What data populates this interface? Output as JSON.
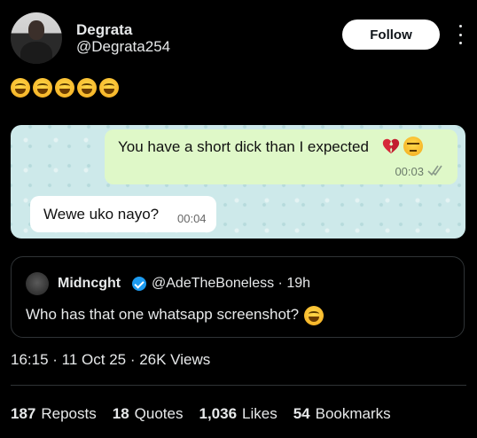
{
  "author": {
    "name": "Degrata",
    "handle": "@Degrata254"
  },
  "follow_label": "Follow",
  "post_emojis": [
    "grinning-squint-emoji",
    "grinning-squint-emoji",
    "grinning-squint-emoji",
    "grinning-squint-emoji",
    "grinning-squint-emoji"
  ],
  "chat": {
    "outgoing": {
      "text": "You have a short dick than I expected",
      "emojis": [
        "broken-heart-emoji",
        "unamused-face-emoji"
      ],
      "time": "00:03"
    },
    "incoming": {
      "text": "Wewe uko nayo?",
      "time": "00:04"
    }
  },
  "quote": {
    "name": "Midncght",
    "handle": "@AdeTheBoneless · 19h",
    "text": "Who has that one whatsapp screenshot?",
    "emoji": "grinning-squint-emoji"
  },
  "meta": "16:15 · 11 Oct 25 · 26K Views",
  "stats": [
    {
      "count": "187",
      "label": "Reposts"
    },
    {
      "count": "18",
      "label": "Quotes"
    },
    {
      "count": "1,036",
      "label": "Likes"
    },
    {
      "count": "54",
      "label": "Bookmarks"
    }
  ],
  "colors": {
    "background": "#000000",
    "text": "#e7e9ea",
    "border": "#2f3336",
    "verified": "#1d9bf0",
    "chat_outgoing": "#dff8c8",
    "chat_background": "#cde9ea"
  }
}
